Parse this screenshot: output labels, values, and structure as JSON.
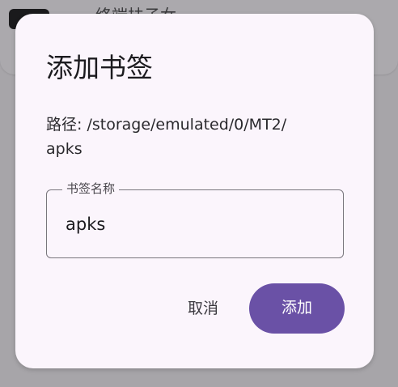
{
  "background": {
    "header_text": "终端扶子女"
  },
  "dialog": {
    "title": "添加书签",
    "path_line1": "路径: /storage/emulated/0/MT2/",
    "path_line2": "apks",
    "field": {
      "label": "书签名称",
      "value": "apks"
    },
    "buttons": {
      "cancel": "取消",
      "confirm": "添加"
    }
  },
  "colors": {
    "scrim": "#a7a5a9",
    "dialog_bg": "#fbf5fc",
    "primary": "#6a51a6",
    "outline": "#79767d",
    "text": "#1c1b1f"
  }
}
